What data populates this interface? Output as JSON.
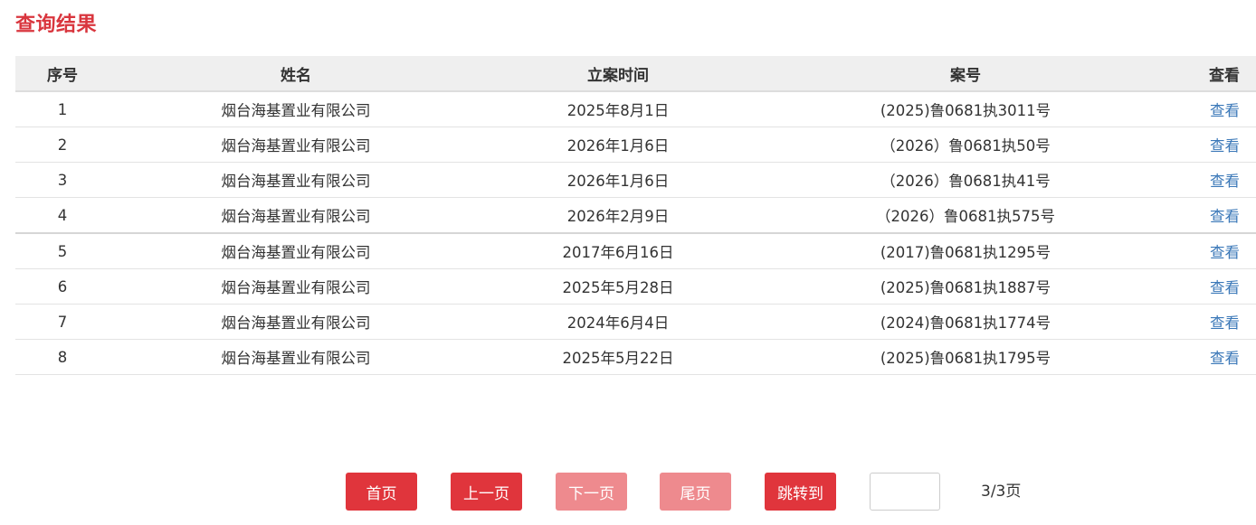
{
  "page": {
    "title": "查询结果"
  },
  "table": {
    "headers": {
      "index": "序号",
      "name": "姓名",
      "date": "立案时间",
      "case_no": "案号",
      "view": "查看"
    },
    "rows": [
      {
        "index": "1",
        "name": "烟台海基置业有限公司",
        "date": "2025年8月1日",
        "case_no": "(2025)鲁0681执3011号",
        "view": "查看"
      },
      {
        "index": "2",
        "name": "烟台海基置业有限公司",
        "date": "2026年1月6日",
        "case_no": "（2026）鲁0681执50号",
        "view": "查看"
      },
      {
        "index": "3",
        "name": "烟台海基置业有限公司",
        "date": "2026年1月6日",
        "case_no": "（2026）鲁0681执41号",
        "view": "查看"
      },
      {
        "index": "4",
        "name": "烟台海基置业有限公司",
        "date": "2026年2月9日",
        "case_no": "（2026）鲁0681执575号",
        "view": "查看"
      },
      {
        "index": "5",
        "name": "烟台海基置业有限公司",
        "date": "2017年6月16日",
        "case_no": "(2017)鲁0681执1295号",
        "view": "查看"
      },
      {
        "index": "6",
        "name": "烟台海基置业有限公司",
        "date": "2025年5月28日",
        "case_no": "(2025)鲁0681执1887号",
        "view": "查看"
      },
      {
        "index": "7",
        "name": "烟台海基置业有限公司",
        "date": "2024年6月4日",
        "case_no": "(2024)鲁0681执1774号",
        "view": "查看"
      },
      {
        "index": "8",
        "name": "烟台海基置业有限公司",
        "date": "2025年5月22日",
        "case_no": "(2025)鲁0681执1795号",
        "view": "查看"
      }
    ]
  },
  "pagination": {
    "first_label": "首页",
    "prev_label": "上一页",
    "next_label": "下一页",
    "last_label": "尾页",
    "jump_label": "跳转到",
    "jump_value": "",
    "page_info": "3/3页"
  },
  "colors": {
    "accent": "#e0353c",
    "disabled": "#ee8a8e",
    "title": "#d9363e",
    "link": "#3b78b8",
    "header_bg": "#efefef"
  }
}
